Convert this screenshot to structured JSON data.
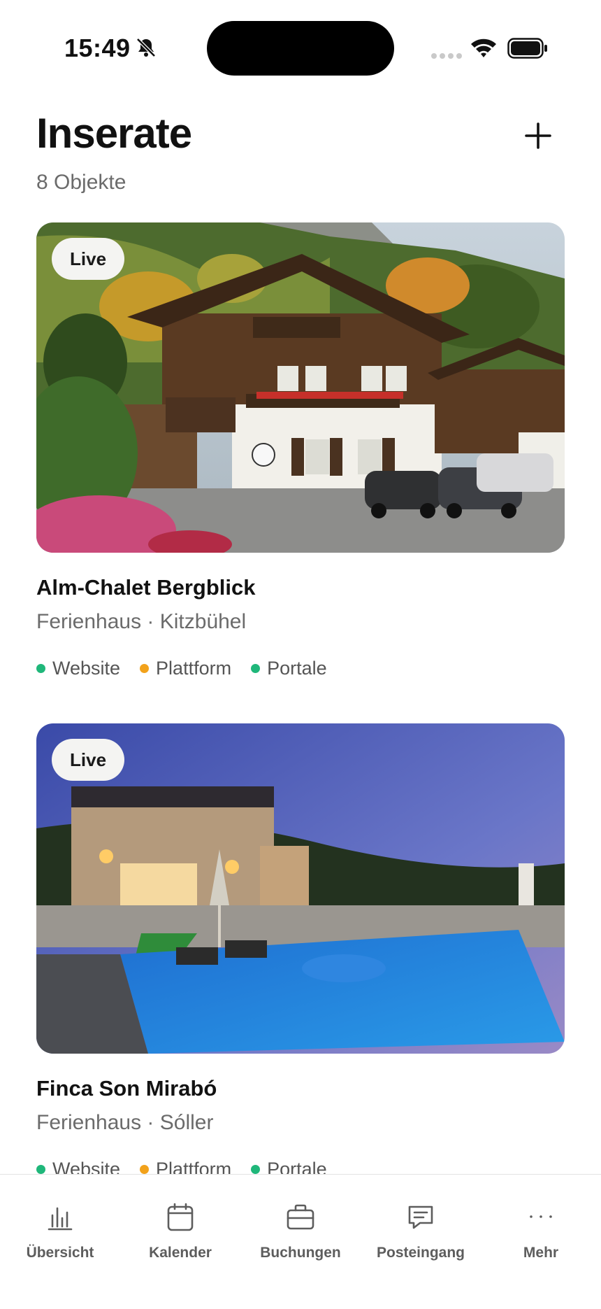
{
  "status_bar": {
    "time": "15:49"
  },
  "header": {
    "title": "Inserate",
    "subtitle": "8 Objekte"
  },
  "listings": [
    {
      "badge": "Live",
      "name": "Alm-Chalet Bergblick",
      "meta": "Ferienhaus · Kitzbühel",
      "channels": [
        {
          "label": "Website",
          "status_color": "#1fb77a"
        },
        {
          "label": "Plattform",
          "status_color": "#f2a21b"
        },
        {
          "label": "Portale",
          "status_color": "#1fb77a"
        }
      ]
    },
    {
      "badge": "Live",
      "name": "Finca Son Mirabó",
      "meta": "Ferienhaus · Sóller",
      "channels": [
        {
          "label": "Website",
          "status_color": "#1fb77a"
        },
        {
          "label": "Plattform",
          "status_color": "#f2a21b"
        },
        {
          "label": "Portale",
          "status_color": "#1fb77a"
        }
      ]
    }
  ],
  "tab_bar": {
    "tabs": [
      {
        "label": "Übersicht",
        "icon": "bar-chart-icon"
      },
      {
        "label": "Kalender",
        "icon": "calendar-icon"
      },
      {
        "label": "Buchungen",
        "icon": "briefcase-icon"
      },
      {
        "label": "Posteingang",
        "icon": "message-icon"
      },
      {
        "label": "Mehr",
        "icon": "more-dots-icon"
      }
    ]
  },
  "colors": {
    "live_green": "#1fb77a",
    "pending_orange": "#f2a21b",
    "text_primary": "#121212",
    "text_secondary": "#6b6b6b"
  }
}
